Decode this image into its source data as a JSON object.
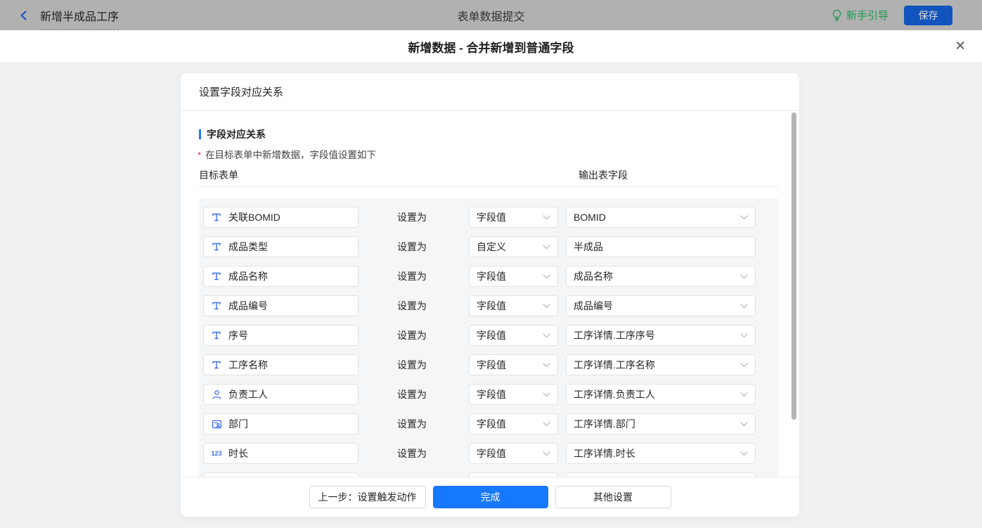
{
  "app_bar": {
    "back_label": "新增半成品工序",
    "center_title": "表单数据提交",
    "guide_label": "新手引导",
    "save_label": "保存"
  },
  "modal": {
    "title": "新增数据 - 合并新增到普通字段"
  },
  "panel": {
    "header": "设置字段对应关系",
    "section_title": "字段对应关系",
    "required_mark": "*",
    "description": "在目标表单中新增数据，字段值设置如下",
    "col_left": "目标表单",
    "col_right": "输出表字段",
    "middle_label": "设置为"
  },
  "rows": [
    {
      "icon": "text-field",
      "field": "关联BOMID",
      "mode": "字段值",
      "value": "BOMID",
      "value_type": "select"
    },
    {
      "icon": "text-field",
      "field": "成品类型",
      "mode": "自定义",
      "value": "半成品",
      "value_type": "input"
    },
    {
      "icon": "text-field",
      "field": "成品名称",
      "mode": "字段值",
      "value": "成品名称",
      "value_type": "select"
    },
    {
      "icon": "text-field",
      "field": "成品编号",
      "mode": "字段值",
      "value": "成品编号",
      "value_type": "select"
    },
    {
      "icon": "text-field",
      "field": "序号",
      "mode": "字段值",
      "value": "工序详情.工序序号",
      "value_type": "select"
    },
    {
      "icon": "text-field",
      "field": "工序名称",
      "mode": "字段值",
      "value": "工序详情.工序名称",
      "value_type": "select"
    },
    {
      "icon": "member",
      "field": "负责工人",
      "mode": "字段值",
      "value": "工序详情.负责工人",
      "value_type": "select"
    },
    {
      "icon": "department",
      "field": "部门",
      "mode": "字段值",
      "value": "工序详情.部门",
      "value_type": "select"
    },
    {
      "icon": "number",
      "field": "时长",
      "mode": "字段值",
      "value": "工序详情.时长",
      "value_type": "select"
    },
    {
      "icon": "text-field",
      "field": "",
      "mode": "",
      "value": "",
      "value_type": "select",
      "partial": true
    }
  ],
  "footer": {
    "prev_label": "上一步：设置触发动作",
    "done_label": "完成",
    "other_label": "其他设置"
  },
  "colors": {
    "accent": "#1677ff",
    "field_icon_blue": "#3d6ef2",
    "guide_green": "#1e9a52",
    "required_red": "#f5222d",
    "dimmed_save_blue": "#1254bd"
  }
}
